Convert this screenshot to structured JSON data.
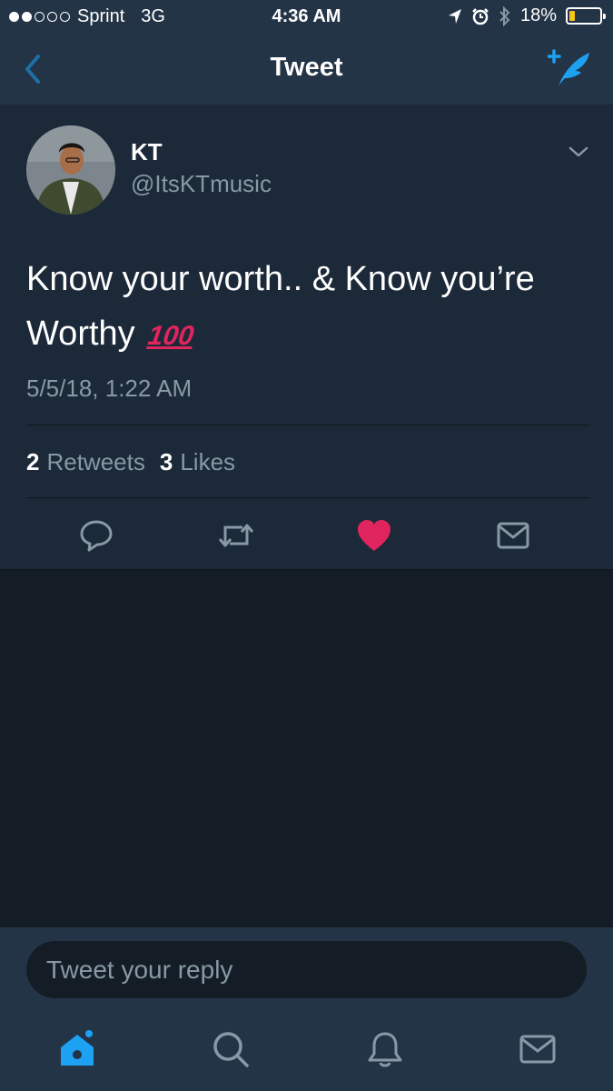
{
  "status_bar": {
    "carrier": "Sprint",
    "network": "3G",
    "time": "4:36 AM",
    "battery": "18%",
    "battery_level": 0.18,
    "signal_bars_filled": 2,
    "signal_bars_total": 5
  },
  "nav": {
    "title": "Tweet",
    "back_icon": "chevron-left-icon",
    "compose_icon": "compose-tweet-icon"
  },
  "tweet": {
    "author_name": "KT",
    "author_handle": "@ItsKTmusic",
    "text": "Know your worth.. & Know you’re Worthy",
    "emoji": "100",
    "timestamp": "5/5/18, 1:22 AM",
    "retweets_count": "2",
    "retweets_label": "Retweets",
    "likes_count": "3",
    "likes_label": "Likes",
    "liked": true
  },
  "reply": {
    "placeholder": "Tweet your reply"
  },
  "tabs": [
    {
      "icon": "home-icon",
      "active": true
    },
    {
      "icon": "search-icon",
      "active": false
    },
    {
      "icon": "notifications-bell-icon",
      "active": false
    },
    {
      "icon": "messages-envelope-icon",
      "active": false
    }
  ],
  "colors": {
    "accent": "#1da1f2",
    "like": "#e0245e",
    "muted": "#8899a6",
    "background": "#141d26",
    "card": "#1c2938",
    "chrome": "#243447"
  }
}
